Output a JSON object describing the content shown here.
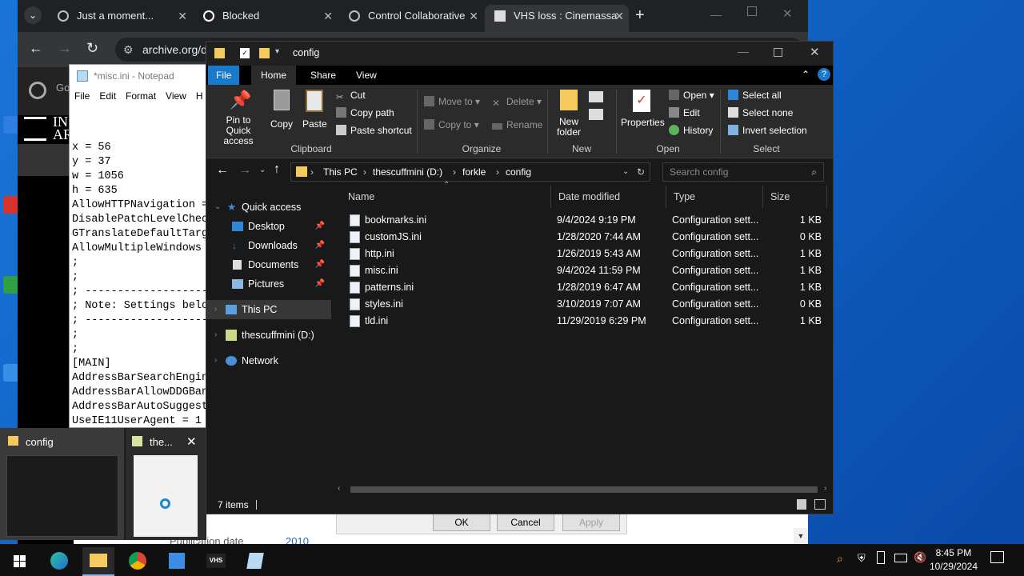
{
  "chrome": {
    "tabs": [
      {
        "label": "Just a moment..."
      },
      {
        "label": "Blocked"
      },
      {
        "label": "Control Collaborative"
      },
      {
        "label": "VHS loss : Cinemassa"
      }
    ],
    "url": "archive.org/d",
    "page_fragments": {
      "logo_a": "IN",
      "logo_b": "AR",
      "meta_label": "Publication date",
      "meta_value": "2010"
    }
  },
  "notepad": {
    "title": "*misc.ini - Notepad",
    "menu": [
      "File",
      "Edit",
      "Format",
      "View",
      "H"
    ],
    "lines": [
      "x = 56",
      "y = 37",
      "w = 1056",
      "h = 635",
      "AllowHTTPNavigation =",
      "DisablePatchLevelChec",
      "GTranslateDefaultTarg",
      "AllowMultipleWindows ",
      ";",
      ";",
      "; -------------------",
      "; Note: Settings belo",
      "; -------------------",
      ";",
      ";",
      "[MAIN]",
      "AddressBarSearchEngin",
      "AddressBarAllowDDGBan",
      "AddressBarAutoSuggest",
      "UseIE11UserAgent = 1"
    ]
  },
  "taskbar_preview": {
    "items": [
      {
        "title": "config"
      },
      {
        "title": "the..."
      }
    ]
  },
  "explorer": {
    "title": "config",
    "ribbon_tabs": [
      "File",
      "Home",
      "Share",
      "View"
    ],
    "ribbon": {
      "clipboard": {
        "pin": "Pin to Quick access",
        "copy": "Copy",
        "paste": "Paste",
        "cut": "Cut",
        "copy_path": "Copy path",
        "paste_shortcut": "Paste shortcut",
        "group": "Clipboard"
      },
      "organize": {
        "move_to": "Move to",
        "copy_to": "Copy to",
        "delete": "Delete",
        "rename": "Rename",
        "group": "Organize"
      },
      "new": {
        "new_folder": "New folder",
        "group": "New"
      },
      "open": {
        "properties": "Properties",
        "open": "Open",
        "edit": "Edit",
        "history": "History",
        "group": "Open"
      },
      "select": {
        "select_all": "Select all",
        "select_none": "Select none",
        "invert": "Invert selection",
        "group": "Select"
      }
    },
    "breadcrumb": [
      "This PC",
      "thescuffmini (D:)",
      "forkle",
      "config"
    ],
    "search_placeholder": "Search config",
    "nav": {
      "quick_access": "Quick access",
      "desktop": "Desktop",
      "downloads": "Downloads",
      "documents": "Documents",
      "pictures": "Pictures",
      "this_pc": "This PC",
      "drive": "thescuffmini (D:)",
      "network": "Network"
    },
    "columns": {
      "name": "Name",
      "date": "Date modified",
      "type": "Type",
      "size": "Size"
    },
    "files": [
      {
        "name": "bookmarks.ini",
        "date": "9/4/2024 9:19 PM",
        "type": "Configuration sett...",
        "size": "1 KB"
      },
      {
        "name": "customJS.ini",
        "date": "1/28/2020 7:44 AM",
        "type": "Configuration sett...",
        "size": "0 KB"
      },
      {
        "name": "http.ini",
        "date": "1/26/2019 5:43 AM",
        "type": "Configuration sett...",
        "size": "1 KB"
      },
      {
        "name": "misc.ini",
        "date": "9/4/2024 11:59 PM",
        "type": "Configuration sett...",
        "size": "1 KB"
      },
      {
        "name": "patterns.ini",
        "date": "1/28/2019 6:47 AM",
        "type": "Configuration sett...",
        "size": "1 KB"
      },
      {
        "name": "styles.ini",
        "date": "3/10/2019 7:07 AM",
        "type": "Configuration sett...",
        "size": "0 KB"
      },
      {
        "name": "tld.ini",
        "date": "11/29/2019 6:29 PM",
        "type": "Configuration sett...",
        "size": "1 KB"
      }
    ],
    "status": "7 items"
  },
  "dialog": {
    "ok": "OK",
    "cancel": "Cancel",
    "apply": "Apply"
  },
  "taskbar": {
    "vhs_label": "VHS",
    "time": "8:45 PM",
    "date": "10/29/2024"
  },
  "colors": {
    "explorer_bg": "#191919",
    "ribbon_bg": "#2b2b2b",
    "file_tab": "#1979ca",
    "desktop": "#1565c8"
  }
}
